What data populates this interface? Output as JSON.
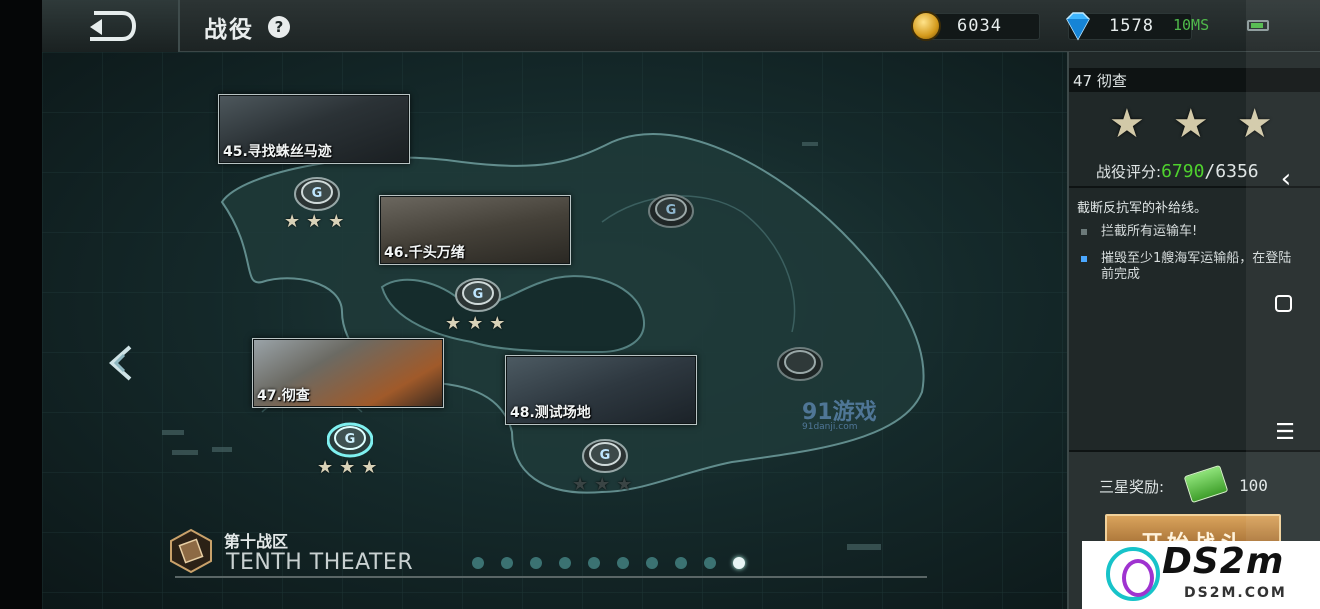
{
  "header": {
    "title": "战役",
    "help_symbol": "?",
    "gold": "6034",
    "gems": "1578",
    "ping": "10MS"
  },
  "missions": [
    {
      "label": "45.寻找蛛丝马迹",
      "stars": 3
    },
    {
      "label": "46.千头万绪",
      "stars": 3
    },
    {
      "label": "47.彻查",
      "stars": 3,
      "selected": true
    },
    {
      "label": "48.测试场地",
      "stars": 0
    }
  ],
  "map": {
    "theater_cn": "第十战区",
    "theater_en": "TENTH THEATER",
    "page_count": 10,
    "active_page": 10,
    "watermark_91": "91游戏",
    "watermark_91_sub": "91danji.com"
  },
  "panel": {
    "mission_title": "47 彻查",
    "stars_earned": 3,
    "score_label": "战役评分:",
    "score_value": "6790",
    "score_sep": "/",
    "score_target": "6356",
    "description": "截断反抗军的补给线。",
    "objectives": [
      {
        "text": "拦截所有运输车!",
        "active": false
      },
      {
        "text": "摧毁至少1艘海军运输船，在登陆前完成",
        "active": true
      }
    ],
    "reward_label": "三星奖励:",
    "reward_value": "100",
    "start_button": "开始战斗"
  },
  "system_nav": {
    "back": "‹",
    "menu": "☰"
  },
  "watermark": {
    "title": "DS2m",
    "subtitle": "DS2M.COM"
  },
  "colors": {
    "score_green": "#4fd12e",
    "ping_green": "#4fb94a",
    "star": "#d9d2b8",
    "active_dot": "#e8f4f4"
  }
}
